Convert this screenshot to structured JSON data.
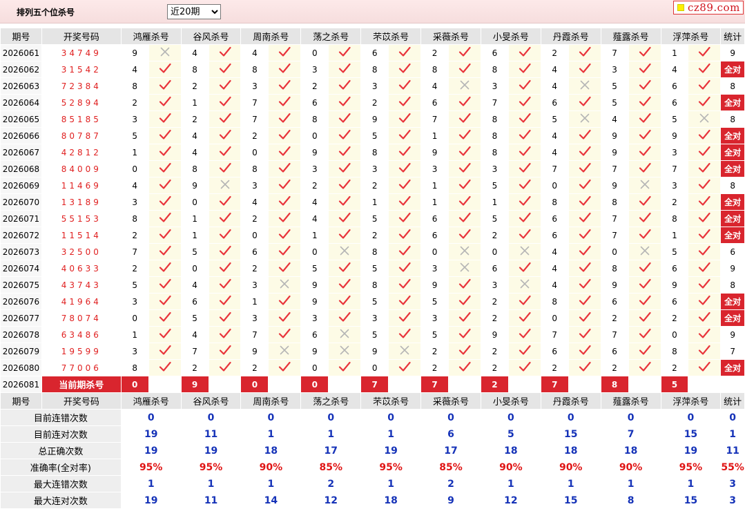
{
  "header": {
    "title": "排列五个位杀号",
    "period_selected": "近20期",
    "period_options": [
      "近20期"
    ]
  },
  "brand": {
    "text": "cz89.com"
  },
  "columns": {
    "issue": "期号",
    "draw": "开奖号码",
    "experts": [
      "鸿雁杀号",
      "谷风杀号",
      "周南杀号",
      "荡之杀号",
      "芣苡杀号",
      "采薇杀号",
      "小旻杀号",
      "丹霞杀号",
      "薤露杀号",
      "浮萍杀号"
    ],
    "stat": "统计"
  },
  "rows": [
    {
      "issue": "2026061",
      "draw": "34749",
      "kills": [
        [
          9,
          "x"
        ],
        [
          4,
          "v"
        ],
        [
          4,
          "v"
        ],
        [
          0,
          "v"
        ],
        [
          6,
          "v"
        ],
        [
          2,
          "v"
        ],
        [
          6,
          "v"
        ],
        [
          2,
          "v"
        ],
        [
          7,
          "v"
        ],
        [
          1,
          "v"
        ]
      ],
      "stat": "9"
    },
    {
      "issue": "2026062",
      "draw": "31542",
      "kills": [
        [
          4,
          "v"
        ],
        [
          8,
          "v"
        ],
        [
          8,
          "v"
        ],
        [
          3,
          "v"
        ],
        [
          8,
          "v"
        ],
        [
          8,
          "v"
        ],
        [
          8,
          "v"
        ],
        [
          4,
          "v"
        ],
        [
          3,
          "v"
        ],
        [
          4,
          "v"
        ]
      ],
      "stat": "全对"
    },
    {
      "issue": "2026063",
      "draw": "72384",
      "kills": [
        [
          8,
          "v"
        ],
        [
          2,
          "v"
        ],
        [
          3,
          "v"
        ],
        [
          2,
          "v"
        ],
        [
          3,
          "v"
        ],
        [
          4,
          "x"
        ],
        [
          3,
          "v"
        ],
        [
          4,
          "x"
        ],
        [
          5,
          "v"
        ],
        [
          6,
          "v"
        ]
      ],
      "stat": "8"
    },
    {
      "issue": "2026064",
      "draw": "52894",
      "kills": [
        [
          2,
          "v"
        ],
        [
          1,
          "v"
        ],
        [
          7,
          "v"
        ],
        [
          6,
          "v"
        ],
        [
          2,
          "v"
        ],
        [
          6,
          "v"
        ],
        [
          7,
          "v"
        ],
        [
          6,
          "v"
        ],
        [
          5,
          "v"
        ],
        [
          6,
          "v"
        ]
      ],
      "stat": "全对"
    },
    {
      "issue": "2026065",
      "draw": "85185",
      "kills": [
        [
          3,
          "v"
        ],
        [
          2,
          "v"
        ],
        [
          7,
          "v"
        ],
        [
          8,
          "v"
        ],
        [
          9,
          "v"
        ],
        [
          7,
          "v"
        ],
        [
          8,
          "v"
        ],
        [
          5,
          "x"
        ],
        [
          4,
          "v"
        ],
        [
          5,
          "x"
        ]
      ],
      "stat": "8"
    },
    {
      "issue": "2026066",
      "draw": "80787",
      "kills": [
        [
          5,
          "v"
        ],
        [
          4,
          "v"
        ],
        [
          2,
          "v"
        ],
        [
          0,
          "v"
        ],
        [
          5,
          "v"
        ],
        [
          1,
          "v"
        ],
        [
          8,
          "v"
        ],
        [
          4,
          "v"
        ],
        [
          9,
          "v"
        ],
        [
          9,
          "v"
        ]
      ],
      "stat": "全对"
    },
    {
      "issue": "2026067",
      "draw": "42812",
      "kills": [
        [
          1,
          "v"
        ],
        [
          4,
          "v"
        ],
        [
          0,
          "v"
        ],
        [
          9,
          "v"
        ],
        [
          8,
          "v"
        ],
        [
          9,
          "v"
        ],
        [
          8,
          "v"
        ],
        [
          4,
          "v"
        ],
        [
          9,
          "v"
        ],
        [
          3,
          "v"
        ]
      ],
      "stat": "全对"
    },
    {
      "issue": "2026068",
      "draw": "84009",
      "kills": [
        [
          0,
          "v"
        ],
        [
          8,
          "v"
        ],
        [
          8,
          "v"
        ],
        [
          3,
          "v"
        ],
        [
          3,
          "v"
        ],
        [
          3,
          "v"
        ],
        [
          3,
          "v"
        ],
        [
          7,
          "v"
        ],
        [
          7,
          "v"
        ],
        [
          7,
          "v"
        ]
      ],
      "stat": "全对"
    },
    {
      "issue": "2026069",
      "draw": "11469",
      "kills": [
        [
          4,
          "v"
        ],
        [
          9,
          "x"
        ],
        [
          3,
          "v"
        ],
        [
          2,
          "v"
        ],
        [
          2,
          "v"
        ],
        [
          1,
          "v"
        ],
        [
          5,
          "v"
        ],
        [
          0,
          "v"
        ],
        [
          9,
          "x"
        ],
        [
          3,
          "v"
        ]
      ],
      "stat": "8"
    },
    {
      "issue": "2026070",
      "draw": "13189",
      "kills": [
        [
          3,
          "v"
        ],
        [
          0,
          "v"
        ],
        [
          4,
          "v"
        ],
        [
          4,
          "v"
        ],
        [
          1,
          "v"
        ],
        [
          1,
          "v"
        ],
        [
          1,
          "v"
        ],
        [
          8,
          "v"
        ],
        [
          8,
          "v"
        ],
        [
          2,
          "v"
        ]
      ],
      "stat": "全对"
    },
    {
      "issue": "2026071",
      "draw": "55153",
      "kills": [
        [
          8,
          "v"
        ],
        [
          1,
          "v"
        ],
        [
          2,
          "v"
        ],
        [
          4,
          "v"
        ],
        [
          5,
          "v"
        ],
        [
          6,
          "v"
        ],
        [
          5,
          "v"
        ],
        [
          6,
          "v"
        ],
        [
          7,
          "v"
        ],
        [
          8,
          "v"
        ]
      ],
      "stat": "全对"
    },
    {
      "issue": "2026072",
      "draw": "11514",
      "kills": [
        [
          2,
          "v"
        ],
        [
          1,
          "v"
        ],
        [
          0,
          "v"
        ],
        [
          1,
          "v"
        ],
        [
          2,
          "v"
        ],
        [
          6,
          "v"
        ],
        [
          2,
          "v"
        ],
        [
          6,
          "v"
        ],
        [
          7,
          "v"
        ],
        [
          1,
          "v"
        ]
      ],
      "stat": "全对"
    },
    {
      "issue": "2026073",
      "draw": "32500",
      "kills": [
        [
          7,
          "v"
        ],
        [
          5,
          "v"
        ],
        [
          6,
          "v"
        ],
        [
          0,
          "x"
        ],
        [
          8,
          "v"
        ],
        [
          0,
          "x"
        ],
        [
          0,
          "x"
        ],
        [
          4,
          "v"
        ],
        [
          0,
          "x"
        ],
        [
          5,
          "v"
        ]
      ],
      "stat": "6"
    },
    {
      "issue": "2026074",
      "draw": "40633",
      "kills": [
        [
          2,
          "v"
        ],
        [
          0,
          "v"
        ],
        [
          2,
          "v"
        ],
        [
          5,
          "v"
        ],
        [
          5,
          "v"
        ],
        [
          3,
          "x"
        ],
        [
          6,
          "v"
        ],
        [
          4,
          "v"
        ],
        [
          8,
          "v"
        ],
        [
          6,
          "v"
        ]
      ],
      "stat": "9"
    },
    {
      "issue": "2026075",
      "draw": "43743",
      "kills": [
        [
          5,
          "v"
        ],
        [
          4,
          "v"
        ],
        [
          3,
          "x"
        ],
        [
          9,
          "v"
        ],
        [
          8,
          "v"
        ],
        [
          9,
          "v"
        ],
        [
          3,
          "x"
        ],
        [
          4,
          "v"
        ],
        [
          9,
          "v"
        ],
        [
          9,
          "v"
        ]
      ],
      "stat": "8"
    },
    {
      "issue": "2026076",
      "draw": "41964",
      "kills": [
        [
          3,
          "v"
        ],
        [
          6,
          "v"
        ],
        [
          1,
          "v"
        ],
        [
          9,
          "v"
        ],
        [
          5,
          "v"
        ],
        [
          5,
          "v"
        ],
        [
          2,
          "v"
        ],
        [
          8,
          "v"
        ],
        [
          6,
          "v"
        ],
        [
          6,
          "v"
        ]
      ],
      "stat": "全对"
    },
    {
      "issue": "2026077",
      "draw": "78074",
      "kills": [
        [
          0,
          "v"
        ],
        [
          5,
          "v"
        ],
        [
          3,
          "v"
        ],
        [
          3,
          "v"
        ],
        [
          3,
          "v"
        ],
        [
          3,
          "v"
        ],
        [
          2,
          "v"
        ],
        [
          0,
          "v"
        ],
        [
          2,
          "v"
        ],
        [
          2,
          "v"
        ]
      ],
      "stat": "全对"
    },
    {
      "issue": "2026078",
      "draw": "63486",
      "kills": [
        [
          1,
          "v"
        ],
        [
          4,
          "v"
        ],
        [
          7,
          "v"
        ],
        [
          6,
          "x"
        ],
        [
          5,
          "v"
        ],
        [
          5,
          "v"
        ],
        [
          9,
          "v"
        ],
        [
          7,
          "v"
        ],
        [
          7,
          "v"
        ],
        [
          0,
          "v"
        ]
      ],
      "stat": "9"
    },
    {
      "issue": "2026079",
      "draw": "19599",
      "kills": [
        [
          3,
          "v"
        ],
        [
          7,
          "v"
        ],
        [
          9,
          "x"
        ],
        [
          9,
          "x"
        ],
        [
          9,
          "x"
        ],
        [
          2,
          "v"
        ],
        [
          2,
          "v"
        ],
        [
          6,
          "v"
        ],
        [
          6,
          "v"
        ],
        [
          8,
          "v"
        ]
      ],
      "stat": "7"
    },
    {
      "issue": "2026080",
      "draw": "77006",
      "kills": [
        [
          8,
          "v"
        ],
        [
          2,
          "v"
        ],
        [
          2,
          "v"
        ],
        [
          0,
          "v"
        ],
        [
          0,
          "v"
        ],
        [
          2,
          "v"
        ],
        [
          2,
          "v"
        ],
        [
          2,
          "v"
        ],
        [
          2,
          "v"
        ],
        [
          2,
          "v"
        ]
      ],
      "stat": "全对"
    }
  ],
  "current": {
    "issue": "2026081",
    "label": "当前期杀号",
    "kills": [
      "0",
      "9",
      "0",
      "0",
      "7",
      "7",
      "2",
      "7",
      "8",
      "5"
    ]
  },
  "summary": [
    {
      "label": "目前连错次数",
      "values": [
        "0",
        "0",
        "0",
        "0",
        "0",
        "0",
        "0",
        "0",
        "0",
        "0"
      ],
      "stat": "0",
      "color": "blue"
    },
    {
      "label": "目前连对次数",
      "values": [
        "19",
        "11",
        "1",
        "1",
        "1",
        "6",
        "5",
        "15",
        "7",
        "15"
      ],
      "stat": "1",
      "color": "blue"
    },
    {
      "label": "总正确次数",
      "values": [
        "19",
        "19",
        "18",
        "17",
        "19",
        "17",
        "18",
        "18",
        "18",
        "19"
      ],
      "stat": "11",
      "color": "blue"
    },
    {
      "label": "准确率(全对率)",
      "values": [
        "95%",
        "95%",
        "90%",
        "85%",
        "95%",
        "85%",
        "90%",
        "90%",
        "90%",
        "95%"
      ],
      "stat": "55%",
      "color": "red"
    },
    {
      "label": "最大连错次数",
      "values": [
        "1",
        "1",
        "1",
        "2",
        "1",
        "2",
        "1",
        "1",
        "1",
        "1"
      ],
      "stat": "3",
      "color": "blue"
    },
    {
      "label": "最大连对次数",
      "values": [
        "19",
        "11",
        "14",
        "12",
        "18",
        "9",
        "12",
        "15",
        "8",
        "15"
      ],
      "stat": "3",
      "color": "blue"
    }
  ],
  "colors": {
    "accent_red": "#d9252e",
    "check_red": "#e8343b",
    "cross_gray": "#b5b5b5",
    "value_blue": "#1532b8"
  }
}
